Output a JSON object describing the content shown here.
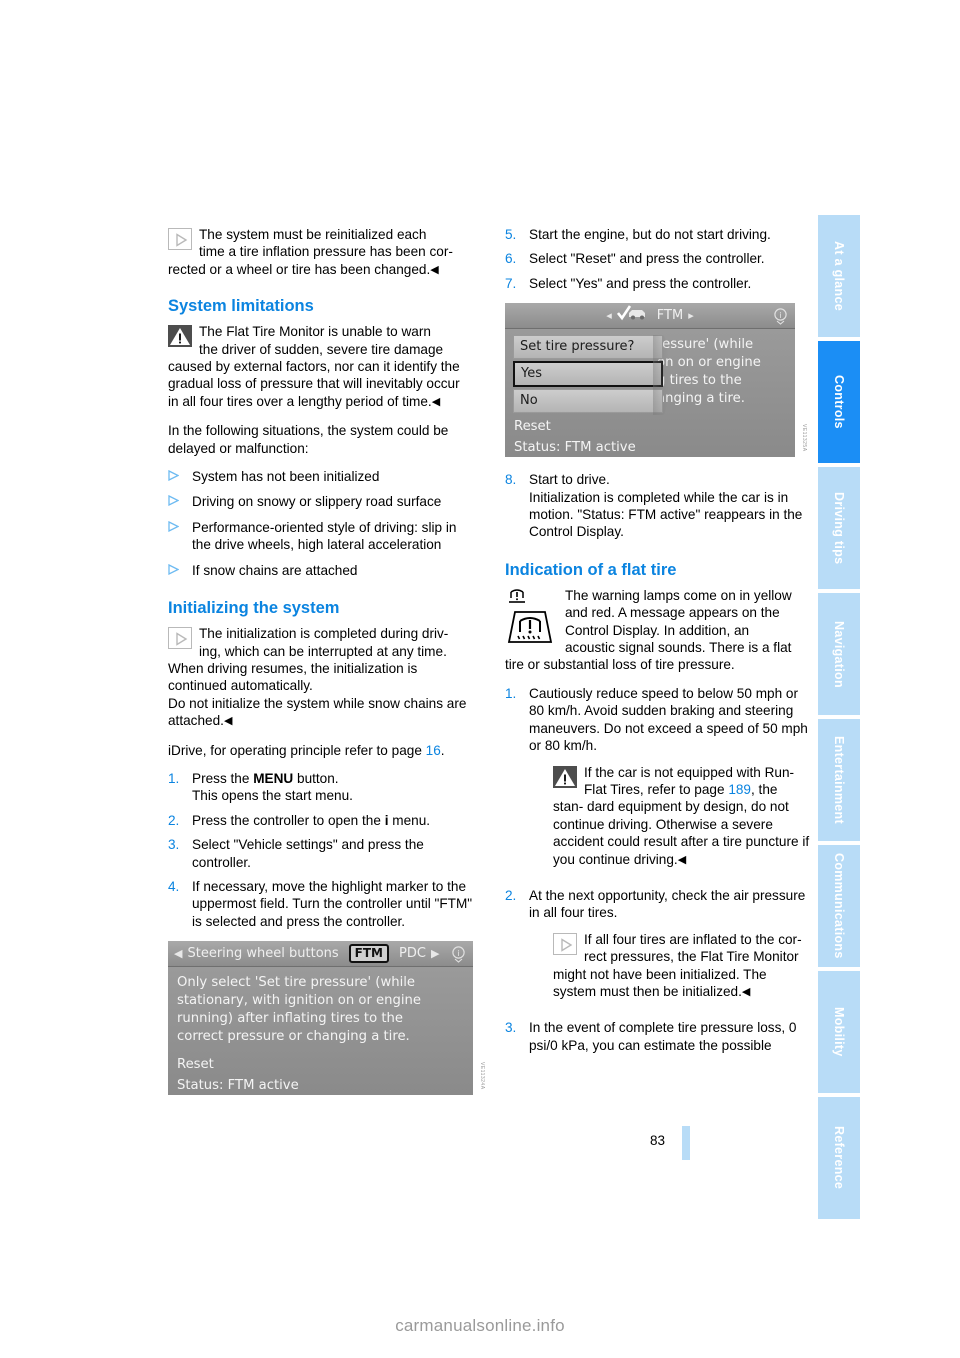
{
  "page": {
    "number": "83",
    "footer_site": "carmanualsonline.info"
  },
  "sidebar": {
    "tabs": [
      {
        "label": "At a glance",
        "active": false
      },
      {
        "label": "Controls",
        "active": true
      },
      {
        "label": "Driving tips",
        "active": false
      },
      {
        "label": "Navigation",
        "active": false
      },
      {
        "label": "Entertainment",
        "active": false
      },
      {
        "label": "Communications",
        "active": false
      },
      {
        "label": "Mobility",
        "active": false
      },
      {
        "label": "Reference",
        "active": false
      }
    ],
    "accent_active": "#1b8ef5",
    "accent_inactive": "#b8dcf7"
  },
  "left_column": {
    "note_top": {
      "icon": "note-icon",
      "text_line1": "The system must be reinitialized each",
      "text_line2": "time a tire inflation pressure has been cor-",
      "text_line3": "rected or a wheel or tire has been changed.",
      "endmark": "◀"
    },
    "heading_system_limitations": "System limitations",
    "warning_limitations": {
      "icon": "warning-triangle-icon",
      "line1": "The Flat Tire Monitor is unable to warn",
      "line2": "the driver of sudden, severe tire damage",
      "rest": "caused by external factors, nor can it identify the gradual loss of pressure that will inevitably occur in all four tires over a lengthy period of time.",
      "endmark": "◀"
    },
    "intro_situations": "In the following situations, the system could be delayed or malfunction:",
    "situations": [
      "System has not been initialized",
      "Driving on snowy or slippery road surface",
      "Performance-oriented style of driving: slip in the drive wheels, high lateral acceleration",
      "If snow chains are attached"
    ],
    "heading_initializing": "Initializing the system",
    "note_initializing": {
      "icon": "note-icon",
      "line1": "The initialization is completed during driv-",
      "line2": "ing, which can be interrupted at any time.",
      "rest1": "When driving resumes, the initialization is continued automatically.",
      "rest2": "Do not initialize the system while snow chains are attached.",
      "endmark": "◀"
    },
    "idrive_ref_pre": "iDrive, for operating principle refer to page ",
    "idrive_ref_page": "16",
    "idrive_ref_post": ".",
    "steps": [
      {
        "num": "1.",
        "text_pre": "Press the ",
        "bold": "MENU",
        "text_post": " button.",
        "sub": "This opens the start menu."
      },
      {
        "num": "2.",
        "text_pre": "Press the controller to open the ",
        "bold": "i",
        "text_post": " menu.",
        "sub": ""
      },
      {
        "num": "3.",
        "text_pre": "Select \"Vehicle settings\" and press the controller.",
        "bold": "",
        "text_post": "",
        "sub": ""
      },
      {
        "num": "4.",
        "text_pre": "If necessary, move the highlight marker to the uppermost field. Turn the controller until \"FTM\" is selected and press the controller.",
        "bold": "",
        "text_post": "",
        "sub": ""
      }
    ],
    "figure": {
      "name": "control-display-ftm-menu",
      "bar": {
        "left_arrow": "◀",
        "title": "Steering wheel buttons",
        "chip": "FTM",
        "next": "PDC",
        "right_arrow": "▶",
        "info_icon": "info-icon"
      },
      "body_lines": [
        "Only select  'Set tire pressure' (while",
        "stationary, with ignition on or engine",
        "running) after inflating tires to the",
        "correct pressure or changing a tire."
      ],
      "reset_label": "Reset",
      "status_label": "Status: FTM active"
    }
  },
  "right_column": {
    "steps_top": [
      {
        "num": "5.",
        "text": "Start the engine, but do not start driving."
      },
      {
        "num": "6.",
        "text": "Select \"Reset\" and press the controller."
      },
      {
        "num": "7.",
        "text": "Select \"Yes\" and press the controller."
      }
    ],
    "figure": {
      "name": "control-display-set-tire-pressure-dialog",
      "bar": {
        "left_arrow": "◂",
        "car_icon": "car-check-icon",
        "title": "FTM",
        "right_arrow": "▸",
        "info_icon": "info-icon"
      },
      "popup": {
        "question": "Set tire pressure?",
        "yes": "Yes",
        "no": "No"
      },
      "body_lines": [
        "ressure' (while",
        "on on or engine",
        "g tires to the",
        "anging a tire."
      ],
      "reset_label": "Reset",
      "status_label": "Status:  FTM active"
    },
    "step_8": {
      "num": "8.",
      "text": "Start to drive.",
      "sub": "Initialization is completed while the car is in motion. \"Status: FTM active\" reappears in the Control Display."
    },
    "heading_indication": "Indication of a flat tire",
    "warning_lamps": {
      "icon_small": "tire-pressure-warning-lamp-small-icon",
      "icon_large": "tire-pressure-warning-lamp-icon",
      "line1": "The warning lamps come on in yellow",
      "line2": "and red. A message appears on the",
      "line3": "Control Display. In addition, an",
      "line4": "acoustic signal sounds. There is a flat",
      "rest": "tire or substantial loss of tire pressure."
    },
    "steps_bottom": [
      {
        "num": "1.",
        "text": "Cautiously reduce speed to below 50 mph or 80 km/h. Avoid sudden braking and steering maneuvers. Do not exceed a speed of 50 mph or 80 km/h."
      },
      {
        "num": "2.",
        "text": "At the next opportunity, check the air pressure in all four tires."
      },
      {
        "num": "3.",
        "text": "In the event of complete tire pressure loss, 0 psi/0 kPa, you can estimate the possible"
      }
    ],
    "warning_runflat": {
      "icon": "warning-triangle-icon",
      "line1": "If the car is not equipped with Run-",
      "line2_pre": "Flat Tires, refer to page ",
      "line2_page": "189",
      "line2_post": ", the stan-",
      "rest": "dard equipment by design, do not continue driving. Otherwise a severe accident could result after a tire puncture if you continue driving.",
      "endmark": "◀"
    },
    "note_pressures": {
      "icon": "note-icon",
      "line1": "If all four tires are inflated to the cor-",
      "line2": "rect pressures, the Flat Tire Monitor",
      "rest": "might not have been initialized. The system must then be initialized.",
      "endmark": "◀"
    }
  }
}
